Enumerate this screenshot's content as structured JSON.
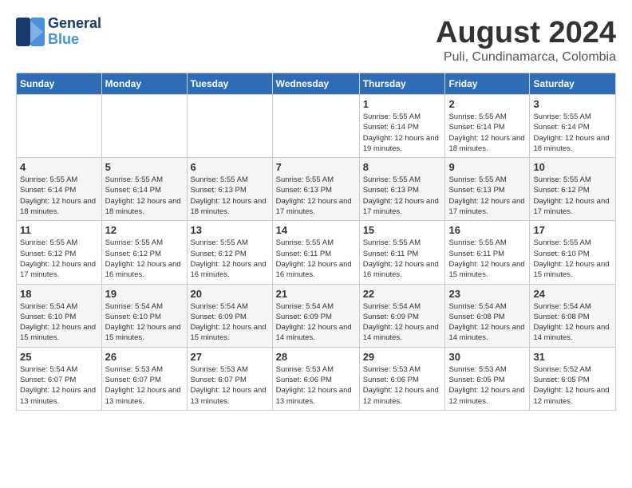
{
  "logo": {
    "text_general": "General",
    "text_blue": "Blue"
  },
  "title": "August 2024",
  "location": "Puli, Cundinamarca, Colombia",
  "weekdays": [
    "Sunday",
    "Monday",
    "Tuesday",
    "Wednesday",
    "Thursday",
    "Friday",
    "Saturday"
  ],
  "weeks": [
    [
      {
        "day": "",
        "info": ""
      },
      {
        "day": "",
        "info": ""
      },
      {
        "day": "",
        "info": ""
      },
      {
        "day": "",
        "info": ""
      },
      {
        "day": "1",
        "sunrise": "5:55 AM",
        "sunset": "6:14 PM",
        "daylight": "12 hours and 19 minutes."
      },
      {
        "day": "2",
        "sunrise": "5:55 AM",
        "sunset": "6:14 PM",
        "daylight": "12 hours and 18 minutes."
      },
      {
        "day": "3",
        "sunrise": "5:55 AM",
        "sunset": "6:14 PM",
        "daylight": "12 hours and 18 minutes."
      }
    ],
    [
      {
        "day": "4",
        "sunrise": "5:55 AM",
        "sunset": "6:14 PM",
        "daylight": "12 hours and 18 minutes."
      },
      {
        "day": "5",
        "sunrise": "5:55 AM",
        "sunset": "6:14 PM",
        "daylight": "12 hours and 18 minutes."
      },
      {
        "day": "6",
        "sunrise": "5:55 AM",
        "sunset": "6:13 PM",
        "daylight": "12 hours and 18 minutes."
      },
      {
        "day": "7",
        "sunrise": "5:55 AM",
        "sunset": "6:13 PM",
        "daylight": "12 hours and 17 minutes."
      },
      {
        "day": "8",
        "sunrise": "5:55 AM",
        "sunset": "6:13 PM",
        "daylight": "12 hours and 17 minutes."
      },
      {
        "day": "9",
        "sunrise": "5:55 AM",
        "sunset": "6:13 PM",
        "daylight": "12 hours and 17 minutes."
      },
      {
        "day": "10",
        "sunrise": "5:55 AM",
        "sunset": "6:12 PM",
        "daylight": "12 hours and 17 minutes."
      }
    ],
    [
      {
        "day": "11",
        "sunrise": "5:55 AM",
        "sunset": "6:12 PM",
        "daylight": "12 hours and 17 minutes."
      },
      {
        "day": "12",
        "sunrise": "5:55 AM",
        "sunset": "6:12 PM",
        "daylight": "12 hours and 16 minutes."
      },
      {
        "day": "13",
        "sunrise": "5:55 AM",
        "sunset": "6:12 PM",
        "daylight": "12 hours and 16 minutes."
      },
      {
        "day": "14",
        "sunrise": "5:55 AM",
        "sunset": "6:11 PM",
        "daylight": "12 hours and 16 minutes."
      },
      {
        "day": "15",
        "sunrise": "5:55 AM",
        "sunset": "6:11 PM",
        "daylight": "12 hours and 16 minutes."
      },
      {
        "day": "16",
        "sunrise": "5:55 AM",
        "sunset": "6:11 PM",
        "daylight": "12 hours and 15 minutes."
      },
      {
        "day": "17",
        "sunrise": "5:55 AM",
        "sunset": "6:10 PM",
        "daylight": "12 hours and 15 minutes."
      }
    ],
    [
      {
        "day": "18",
        "sunrise": "5:54 AM",
        "sunset": "6:10 PM",
        "daylight": "12 hours and 15 minutes."
      },
      {
        "day": "19",
        "sunrise": "5:54 AM",
        "sunset": "6:10 PM",
        "daylight": "12 hours and 15 minutes."
      },
      {
        "day": "20",
        "sunrise": "5:54 AM",
        "sunset": "6:09 PM",
        "daylight": "12 hours and 15 minutes."
      },
      {
        "day": "21",
        "sunrise": "5:54 AM",
        "sunset": "6:09 PM",
        "daylight": "12 hours and 14 minutes."
      },
      {
        "day": "22",
        "sunrise": "5:54 AM",
        "sunset": "6:09 PM",
        "daylight": "12 hours and 14 minutes."
      },
      {
        "day": "23",
        "sunrise": "5:54 AM",
        "sunset": "6:08 PM",
        "daylight": "12 hours and 14 minutes."
      },
      {
        "day": "24",
        "sunrise": "5:54 AM",
        "sunset": "6:08 PM",
        "daylight": "12 hours and 14 minutes."
      }
    ],
    [
      {
        "day": "25",
        "sunrise": "5:54 AM",
        "sunset": "6:07 PM",
        "daylight": "12 hours and 13 minutes."
      },
      {
        "day": "26",
        "sunrise": "5:53 AM",
        "sunset": "6:07 PM",
        "daylight": "12 hours and 13 minutes."
      },
      {
        "day": "27",
        "sunrise": "5:53 AM",
        "sunset": "6:07 PM",
        "daylight": "12 hours and 13 minutes."
      },
      {
        "day": "28",
        "sunrise": "5:53 AM",
        "sunset": "6:06 PM",
        "daylight": "12 hours and 13 minutes."
      },
      {
        "day": "29",
        "sunrise": "5:53 AM",
        "sunset": "6:06 PM",
        "daylight": "12 hours and 12 minutes."
      },
      {
        "day": "30",
        "sunrise": "5:53 AM",
        "sunset": "6:05 PM",
        "daylight": "12 hours and 12 minutes."
      },
      {
        "day": "31",
        "sunrise": "5:52 AM",
        "sunset": "6:05 PM",
        "daylight": "12 hours and 12 minutes."
      }
    ]
  ]
}
